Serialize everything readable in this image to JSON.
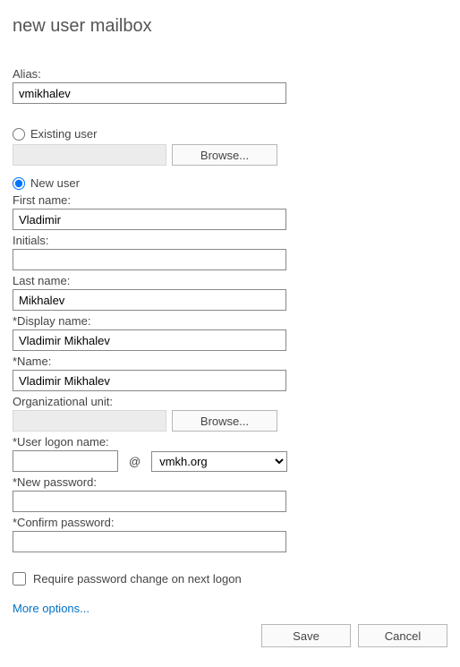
{
  "title": "new user mailbox",
  "labels": {
    "alias": "Alias:",
    "existing_user": "Existing user",
    "new_user": "New user",
    "first_name": "First name:",
    "initials": "Initials:",
    "last_name": "Last name:",
    "display_name": "*Display name:",
    "name": "*Name:",
    "org_unit": "Organizational unit:",
    "user_logon_name": "*User logon name:",
    "new_password": "*New password:",
    "confirm_password": "*Confirm password:",
    "require_pwd_change": "Require password change on next logon"
  },
  "values": {
    "alias": "vmikhalev",
    "first_name": "Vladimir",
    "initials": "",
    "last_name": "Mikhalev",
    "display_name": "Vladimir Mikhalev",
    "name": "Vladimir Mikhalev",
    "logon_name": "",
    "domain": "vmkh.org",
    "new_password": "",
    "confirm_password": ""
  },
  "buttons": {
    "browse": "Browse...",
    "save": "Save",
    "cancel": "Cancel"
  },
  "more_options": "More options...",
  "at": "@"
}
